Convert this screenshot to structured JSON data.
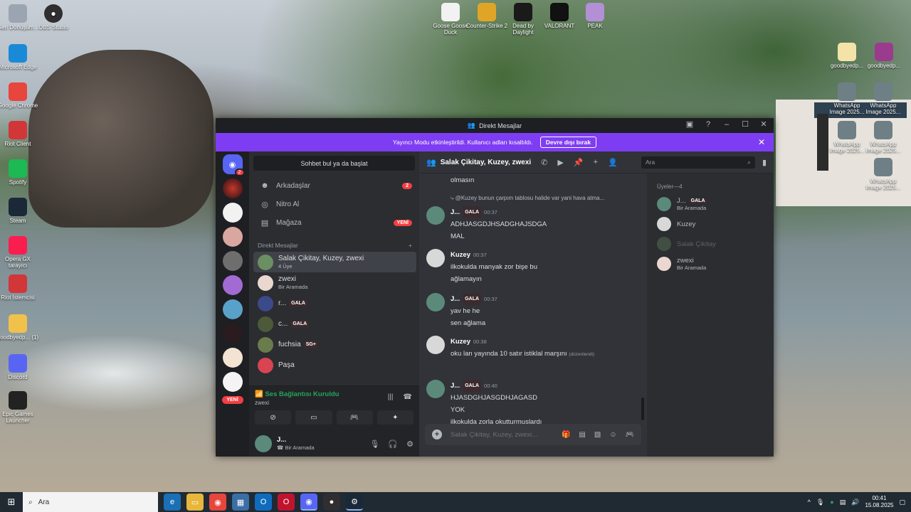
{
  "desktop": {
    "left_icons": [
      {
        "label": "Geri Dönüşüm...",
        "icon": "recycle-bin-icon",
        "color": "#9aa5b1"
      },
      {
        "label": "Microsoft Edge",
        "icon": "edge-icon",
        "color": "#1b8ad6"
      },
      {
        "label": "Google Chrome",
        "icon": "chrome-icon",
        "color": "#e8453c"
      },
      {
        "label": "Riot Client",
        "icon": "riot-icon",
        "color": "#d13639"
      },
      {
        "label": "Spotify",
        "icon": "spotify-icon",
        "color": "#1db954"
      },
      {
        "label": "Steam",
        "icon": "steam-icon",
        "color": "#1b2838"
      },
      {
        "label": "Opera GX tarayıcı",
        "icon": "opera-gx-icon",
        "color": "#fa1e4e"
      },
      {
        "label": "Riot İstemcisi",
        "icon": "riot-icon",
        "color": "#d13639"
      },
      {
        "label": "goodbyedp... (1)",
        "icon": "folder-icon",
        "color": "#f0c24b"
      },
      {
        "label": "Discord",
        "icon": "discord-icon",
        "color": "#5865f2"
      },
      {
        "label": "Epic Games Launcher",
        "icon": "epic-icon",
        "color": "#222"
      }
    ],
    "obs_icon": {
      "label": "OBS Studio",
      "icon": "obs-icon",
      "color": "#302e31"
    },
    "top_icons": [
      {
        "label": "Goose Goose Duck",
        "icon": "goose-icon",
        "color": "#f2f2f2"
      },
      {
        "label": "Counter-Strike 2",
        "icon": "cs2-icon",
        "color": "#e0a526"
      },
      {
        "label": "Dead by Daylight",
        "icon": "dbd-icon",
        "color": "#1a1a1a"
      },
      {
        "label": "VALORANT",
        "icon": "valorant-icon",
        "color": "#111"
      },
      {
        "label": "PEAK",
        "icon": "peak-icon",
        "color": "#b38fd6"
      }
    ],
    "right_icons": [
      {
        "label": "goodbyedp...",
        "icon": "file-icon",
        "color": "#f3e3a8"
      },
      {
        "label": "goodbyedp...",
        "icon": "winrar-icon",
        "color": "#9b3b8e"
      },
      {
        "label": "WhatsApp Image 2025...",
        "icon": "image-icon",
        "color": "#6f7f86"
      },
      {
        "label": "WhatsApp Image 2025...",
        "icon": "image-icon",
        "color": "#6f7f86"
      },
      {
        "label": "WhatsApp Image 2025...",
        "icon": "image-icon",
        "color": "#6f7f86"
      },
      {
        "label": "WhatsApp Image 2025...",
        "icon": "image-icon",
        "color": "#6f7f86"
      },
      {
        "label": "WhatsApp Image 2025...",
        "icon": "image-icon",
        "color": "#6f7f86"
      }
    ]
  },
  "window": {
    "title": "Direkt Mesajlar",
    "controls": {
      "minimize": "–",
      "maximize": "☐",
      "close": "✕"
    }
  },
  "banner": {
    "text": "Yayıncı Modu etkinleştirildi. Kullanıcı adları kısaltıldı.",
    "button": "Devre dışı bırak",
    "close": "✕",
    "color": "#7f3df3"
  },
  "guilds": {
    "dm_badge": "2",
    "second_badge": "",
    "new_label": "YENİ"
  },
  "dm": {
    "search_placeholder": "Sohbet bul ya da başlat",
    "nav": [
      {
        "label": "Arkadaşlar",
        "badge": "2",
        "icon": "friends-icon"
      },
      {
        "label": "Nitro Al",
        "badge": "",
        "icon": "nitro-icon"
      },
      {
        "label": "Mağaza",
        "badge": "YENİ",
        "icon": "shop-icon"
      }
    ],
    "section_title": "Direkt Mesajlar",
    "add": "+",
    "conversations": [
      {
        "name": "Salak Çikitay, Kuzey, zwexi",
        "sub": "4 Üye",
        "tag": "",
        "selected": true
      },
      {
        "name": "zwexi",
        "sub": "Bir Aramada",
        "tag": ""
      },
      {
        "name": "r...",
        "sub": "",
        "tag": "GALA"
      },
      {
        "name": "c...",
        "sub": "",
        "tag": "GALA"
      },
      {
        "name": "fuchsia",
        "sub": "",
        "tag": "SG+"
      },
      {
        "name": "Paşa",
        "sub": "",
        "tag": ""
      }
    ]
  },
  "voice": {
    "status": "Ses Bağlantısı Kuruldu",
    "channel": "zwexi"
  },
  "user": {
    "name": "J...",
    "status": "Bir Aramada"
  },
  "chat": {
    "title": "Salak Çikitay, Kuzey, zwexi",
    "search_placeholder": "Ara",
    "partial_line": "olmasın",
    "reply_preview": "@Kuzey bunun çarpım tablosu halide var yani hava atma...",
    "messages": [
      {
        "author": "J...",
        "tag": "GALA",
        "time": "00:37",
        "lines": [
          "ADHJASGDJHSADGHAJSDGA",
          "MAL"
        ]
      },
      {
        "author": "Kuzey",
        "tag": "",
        "time": "00:37",
        "lines": [
          "ilkokulda manyak zor bişe bu",
          "ağlamayın"
        ]
      },
      {
        "author": "J...",
        "tag": "GALA",
        "time": "00:37",
        "lines": [
          "yav he he",
          "sen ağlama"
        ]
      },
      {
        "author": "Kuzey",
        "tag": "",
        "time": "00:38",
        "lines": [
          "oku lan yayında 10 satır istiklal marşını"
        ],
        "edited": "(düzenlendi)"
      },
      {
        "author": "J...",
        "tag": "GALA",
        "time": "00:40",
        "lines": [
          "HJASDGHJASGDHJAGASD",
          "YOK",
          "ilkokulda zorla okutturmuslardı"
        ]
      }
    ],
    "composer_placeholder": "Salak Çikitay, Kuzey, zwexi..."
  },
  "members": {
    "header": "Üyeler—4",
    "list": [
      {
        "name": "J...",
        "tag": "GALA",
        "sub": "Bir Aramada",
        "offline": false
      },
      {
        "name": "Kuzey",
        "tag": "",
        "sub": "",
        "offline": false
      },
      {
        "name": "Salak Çikitay",
        "tag": "",
        "sub": "",
        "offline": true
      },
      {
        "name": "zwexi",
        "tag": "",
        "sub": "Bir Aramada",
        "offline": false
      }
    ]
  },
  "taskbar": {
    "search": "Ara",
    "time": "00:41",
    "date": "15.08.2025"
  }
}
